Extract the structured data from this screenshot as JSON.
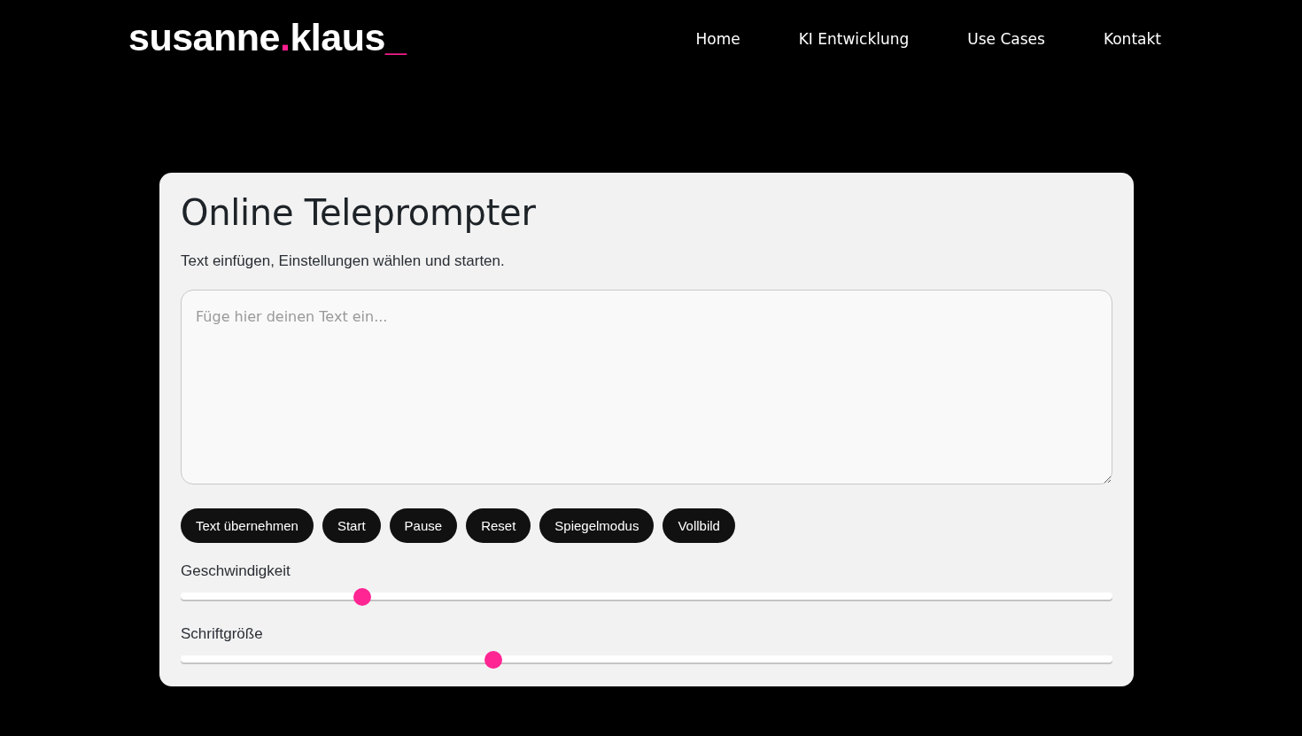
{
  "header": {
    "logo": [
      {
        "text": "susanne",
        "accent": false
      },
      {
        "text": ".",
        "accent": true
      },
      {
        "text": "klaus",
        "accent": false
      },
      {
        "text": "_",
        "accent": true
      }
    ],
    "nav": [
      {
        "label": "Home"
      },
      {
        "label": "KI Entwicklung"
      },
      {
        "label": "Use Cases"
      },
      {
        "label": "Kontakt"
      }
    ]
  },
  "card": {
    "title": "Online Teleprompter",
    "subtitle": "Text einfügen, Einstellungen wählen und starten.",
    "textarea": {
      "placeholder": "Füge hier deinen Text ein..."
    },
    "buttons": [
      "Text übernehmen",
      "Start",
      "Pause",
      "Reset",
      "Spiegelmodus",
      "Vollbild"
    ],
    "sliders": [
      {
        "label": "Geschwindigkeit",
        "level": 0.195
      },
      {
        "label": "Schriftgröße",
        "level": 0.336
      }
    ]
  }
}
